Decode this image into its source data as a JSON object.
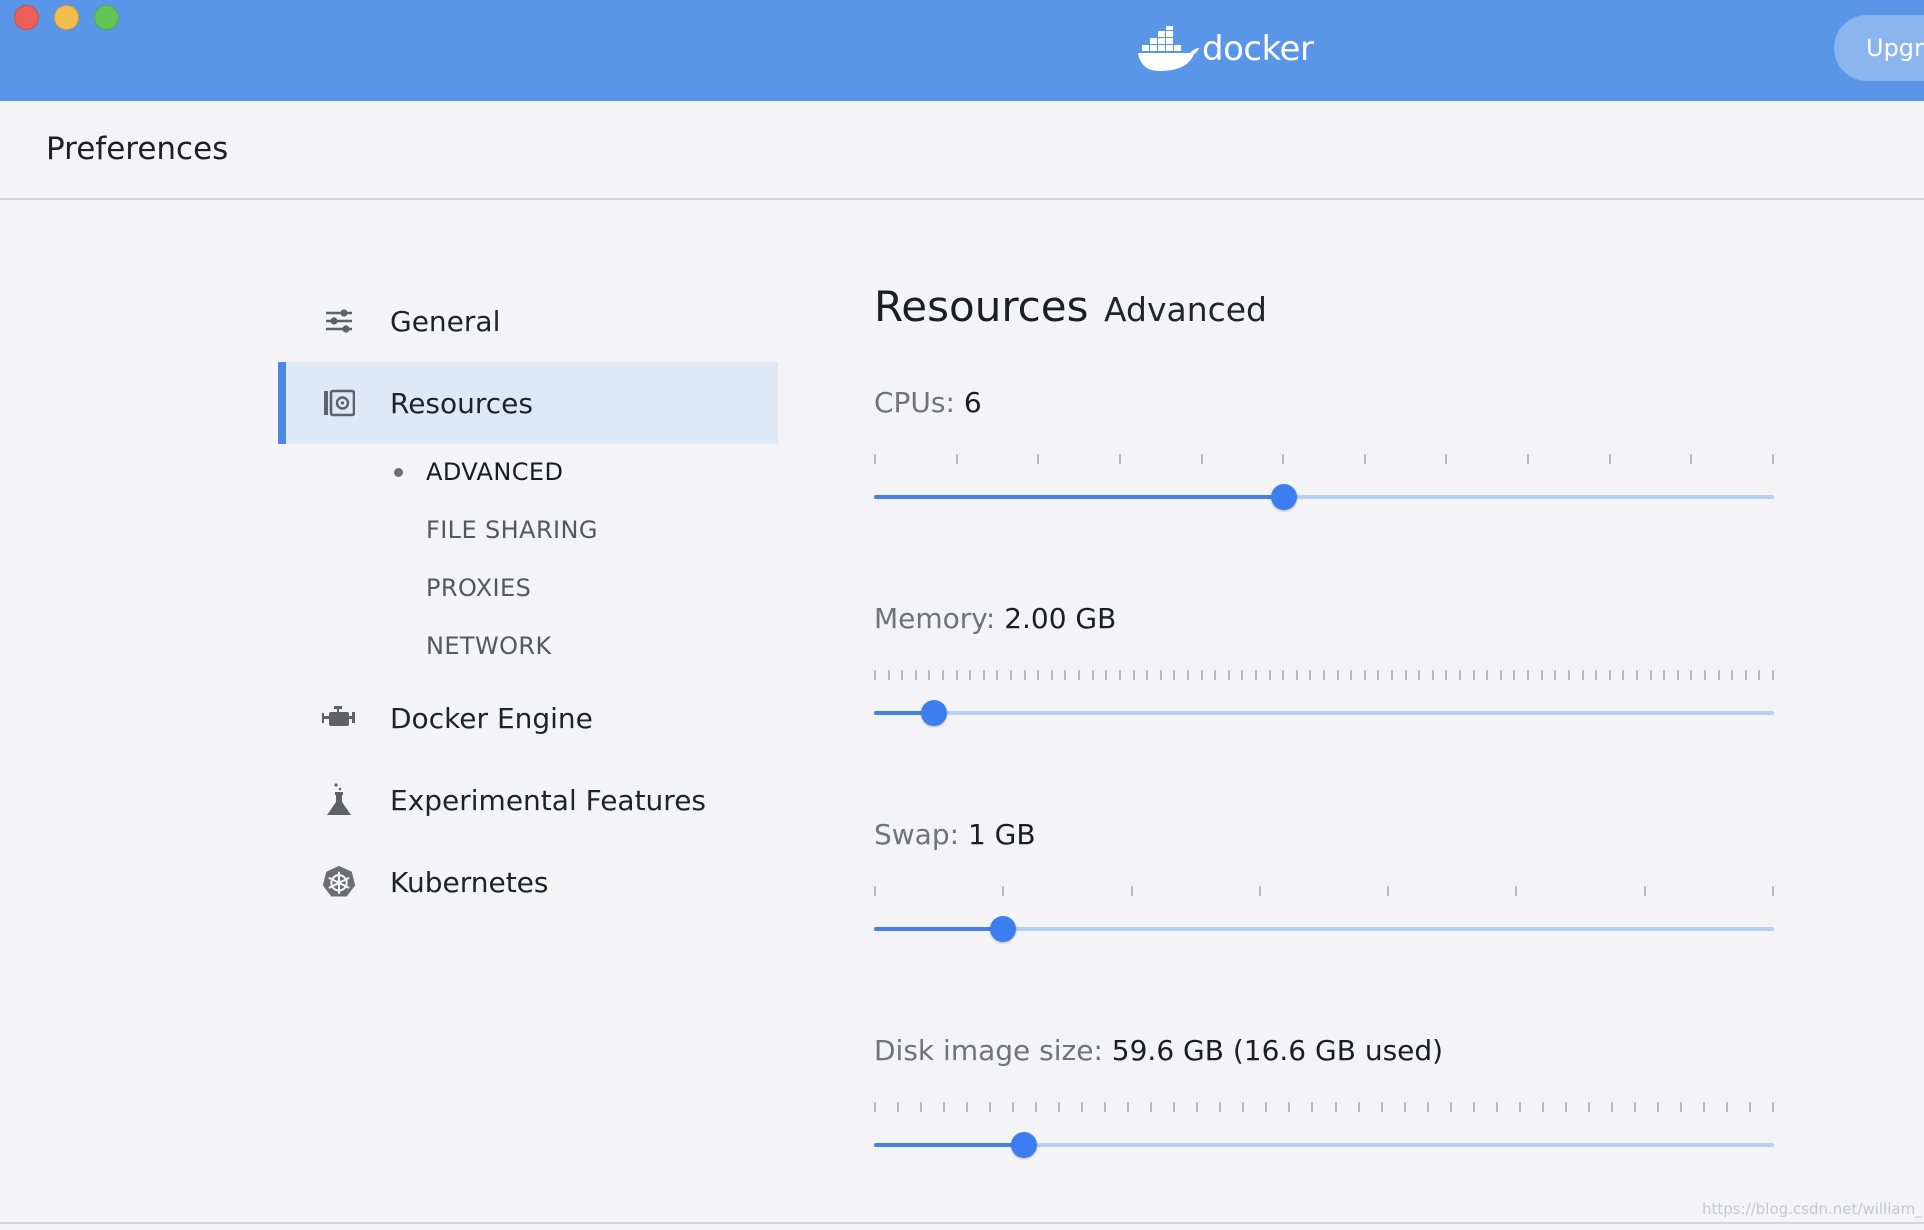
{
  "window": {
    "brand": "docker",
    "upgrade_label": "Upgra",
    "colors": {
      "titlebar": "#5a96e8",
      "accent": "#4e86e6",
      "slider_thumb": "#3c7ef0"
    }
  },
  "header": {
    "title": "Preferences"
  },
  "sidebar": {
    "items": [
      {
        "label": "General",
        "icon": "sliders-icon",
        "active": false
      },
      {
        "label": "Resources",
        "icon": "disk-icon",
        "active": true
      },
      {
        "label": "Docker Engine",
        "icon": "engine-icon",
        "active": false
      },
      {
        "label": "Experimental Features",
        "icon": "flask-icon",
        "active": false
      },
      {
        "label": "Kubernetes",
        "icon": "helm-wheel-icon",
        "active": false
      }
    ],
    "subitems": [
      {
        "label": "ADVANCED",
        "active": true
      },
      {
        "label": "FILE SHARING",
        "active": false
      },
      {
        "label": "PROXIES",
        "active": false
      },
      {
        "label": "NETWORK",
        "active": false
      }
    ]
  },
  "main": {
    "title": "Resources",
    "subtitle": "Advanced",
    "settings": [
      {
        "id": "cpus",
        "label": "CPUs:",
        "value": "6",
        "ticks": 12,
        "fraction": 0.4554
      },
      {
        "id": "memory",
        "label": "Memory:",
        "value": "2.00 GB",
        "ticks": 67,
        "fraction": 0.0667
      },
      {
        "id": "swap",
        "label": "Swap:",
        "value": "1 GB",
        "ticks": 8,
        "fraction": 0.1429
      },
      {
        "id": "disk",
        "label": "Disk image size:",
        "value": "59.6 GB (16.6 GB used)",
        "ticks": 40,
        "fraction": 0.1667
      }
    ]
  },
  "watermark": "https://blog.csdn.net/william_n"
}
